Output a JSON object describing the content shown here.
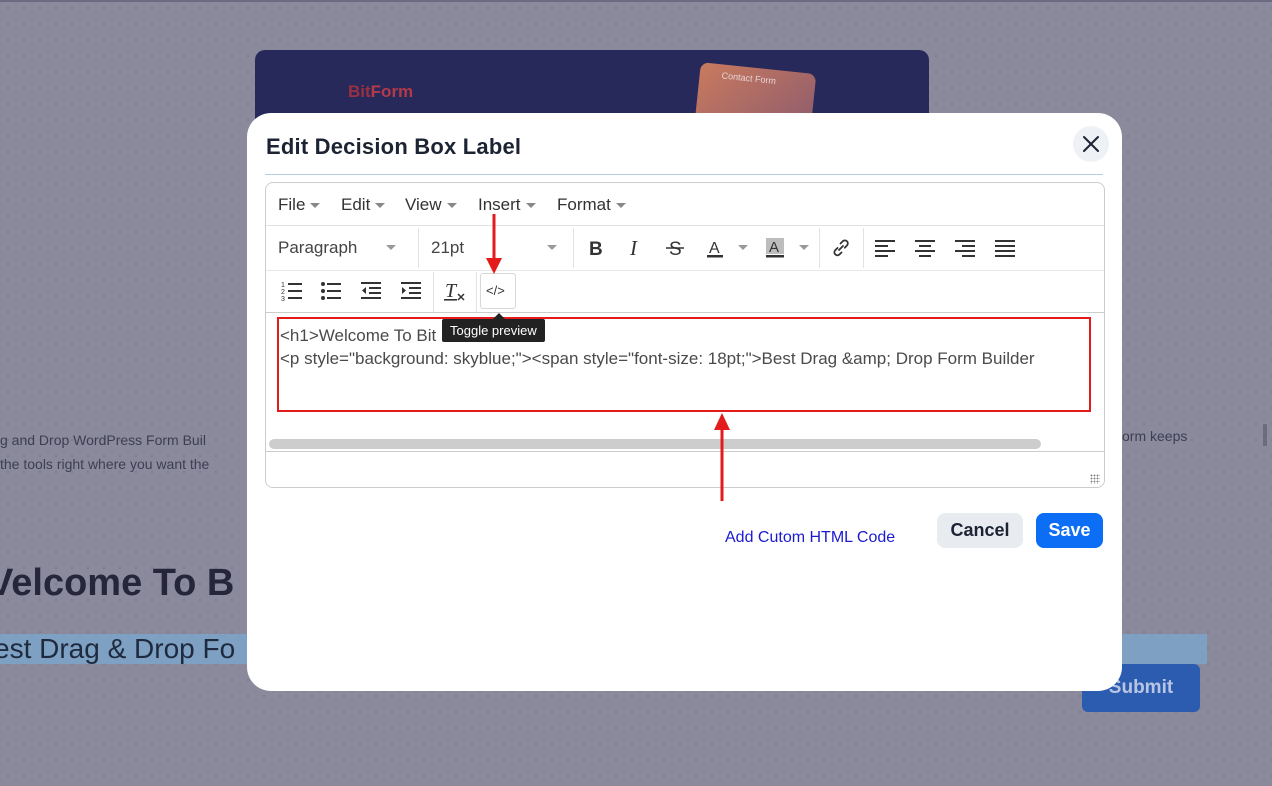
{
  "background": {
    "logo_bit": "Bit",
    "logo_form": "Form",
    "card_text": "Contact Form",
    "desc_left_line1": "g and Drop WordPress Form Buil",
    "desc_left_line2": "the tools right where you want the",
    "desc_right": "orm keeps",
    "heading": "Velcome To B",
    "highlight_text": "est Drag & Drop Fo",
    "submit_label": "Submit"
  },
  "modal": {
    "title": "Edit Decision Box Label",
    "close_icon": "close-icon"
  },
  "editor": {
    "menubar": [
      "File",
      "Edit",
      "View",
      "Insert",
      "Format"
    ],
    "block_format": "Paragraph",
    "font_size": "21pt",
    "toolbar_icons": [
      "bold-icon",
      "italic-icon",
      "strikethrough-icon",
      "text-color-icon",
      "background-color-icon",
      "link-icon",
      "align-left-icon",
      "align-center-icon",
      "align-right-icon",
      "align-justify-icon",
      "numbered-list-icon",
      "bullet-list-icon",
      "outdent-icon",
      "indent-icon",
      "clear-formatting-icon",
      "code-view-icon"
    ],
    "code_lines": [
      "<h1>Welcome To Bit Form</h1>",
      "<p style=\"background: skyblue;\"><span style=\"font-size: 18pt;\">Best Drag &amp; Drop Form Builder"
    ],
    "tooltip": "Toggle preview"
  },
  "annotation": {
    "label": "Add Cutom HTML Code",
    "color": "#e31b1b"
  },
  "actions": {
    "cancel_label": "Cancel",
    "save_label": "Save"
  },
  "colors": {
    "accent": "#0b6ef5",
    "overlay": "#8a8a9c"
  }
}
